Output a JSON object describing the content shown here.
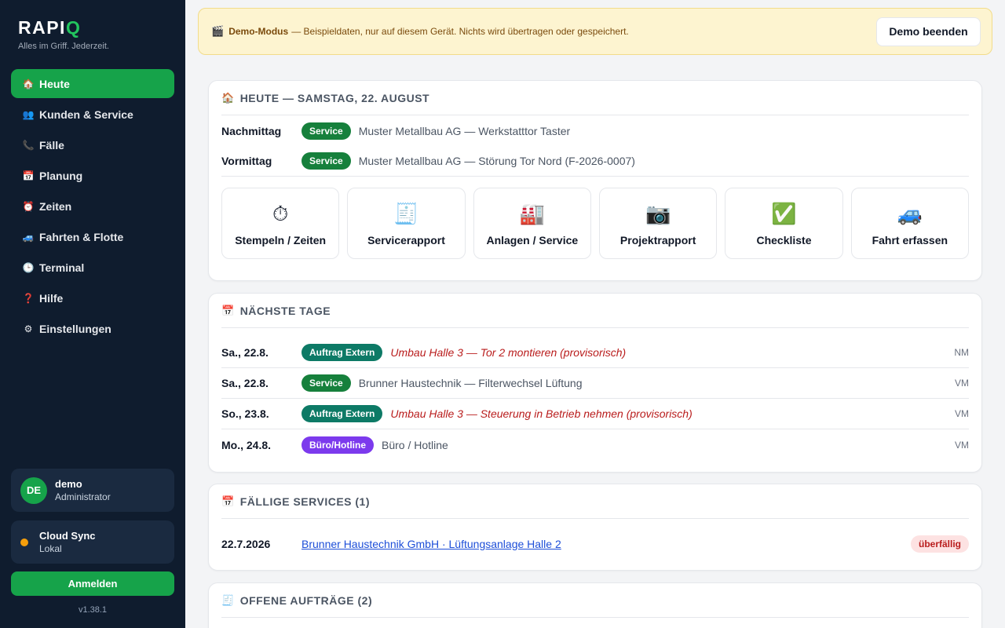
{
  "app": {
    "logo_main": "RAPI",
    "logo_accent": "Q",
    "tagline": "Alles im Griff. Jederzeit.",
    "version": "v1.38.1"
  },
  "nav": [
    {
      "label": "Heute",
      "icon": "house-icon",
      "glyph": "🏠",
      "active": true
    },
    {
      "label": "Kunden & Service",
      "icon": "people-icon",
      "glyph": "👥"
    },
    {
      "label": "Fälle",
      "icon": "phone-icon",
      "glyph": "📞"
    },
    {
      "label": "Planung",
      "icon": "calendar-icon",
      "glyph": "📅"
    },
    {
      "label": "Zeiten",
      "icon": "alarm-clock-icon",
      "glyph": "⏰"
    },
    {
      "label": "Fahrten & Flotte",
      "icon": "car-icon",
      "glyph": "🚙"
    },
    {
      "label": "Terminal",
      "icon": "clock-icon",
      "glyph": "🕒"
    },
    {
      "label": "Hilfe",
      "icon": "question-icon",
      "glyph": "❓"
    },
    {
      "label": "Einstellungen",
      "icon": "gear-icon",
      "glyph": "⚙"
    }
  ],
  "user": {
    "initials": "DE",
    "name": "demo",
    "role": "Administrator"
  },
  "sync": {
    "title": "Cloud Sync",
    "status": "Lokal"
  },
  "login_label": "Anmelden",
  "banner": {
    "icon": "clapper-icon",
    "title": "Demo-Modus",
    "text": "— Beispieldaten, nur auf diesem Gerät. Nichts wird übertragen oder gespeichert.",
    "button": "Demo beenden"
  },
  "today": {
    "title": "Heute — Samstag, 22. August",
    "rows": [
      {
        "label": "Nachmittag",
        "badge": "Service",
        "text": "Muster Metallbau AG — Werkstatttor Taster"
      },
      {
        "label": "Vormittag",
        "badge": "Service",
        "text": "Muster Metallbau AG — Störung Tor Nord (F-2026-0007)"
      }
    ],
    "tiles": [
      {
        "label": "Stempeln / Zeiten",
        "icon": "stopwatch-icon",
        "glyph": "⏱"
      },
      {
        "label": "Servicerapport",
        "icon": "receipt-icon",
        "glyph": "🧾"
      },
      {
        "label": "Anlagen / Service",
        "icon": "factory-icon",
        "glyph": "🏭"
      },
      {
        "label": "Projektrapport",
        "icon": "camera-icon",
        "glyph": "📷"
      },
      {
        "label": "Checkliste",
        "icon": "checkmark-icon",
        "glyph": "✅"
      },
      {
        "label": "Fahrt erfassen",
        "icon": "car-icon",
        "glyph": "🚙"
      }
    ]
  },
  "next_days": {
    "title": "Nächste Tage",
    "rows": [
      {
        "date": "Sa., 22.8.",
        "badge": "Auftrag Extern",
        "kind": "extern",
        "text": "Umbau Halle 3 — Tor 2 montieren (provisorisch)",
        "provisional": true,
        "slot": "NM"
      },
      {
        "date": "Sa., 22.8.",
        "badge": "Service",
        "kind": "service",
        "text": "Brunner Haustechnik — Filterwechsel Lüftung",
        "provisional": false,
        "slot": "VM"
      },
      {
        "date": "So., 23.8.",
        "badge": "Auftrag Extern",
        "kind": "extern",
        "text": "Umbau Halle 3 — Steuerung in Betrieb nehmen (provisorisch)",
        "provisional": true,
        "slot": "VM"
      },
      {
        "date": "Mo., 24.8.",
        "badge": "Büro/Hotline",
        "kind": "buero",
        "text": "Büro / Hotline",
        "provisional": false,
        "slot": "VM"
      }
    ]
  },
  "due_services": {
    "title": "Fällige Services (1)",
    "rows": [
      {
        "date": "22.7.2026",
        "link": "Brunner Haustechnik GmbH · Lüftungsanlage Halle 2",
        "status": "überfällig"
      }
    ]
  },
  "open_orders": {
    "title": "Offene Aufträge (2)"
  },
  "colors": {
    "sidebar_bg": "#0f1c2e",
    "accent_green": "#16a34a",
    "badge_extern": "#0d7a66",
    "badge_buero": "#7c3aed",
    "provisional_red": "#b91c1c",
    "sync_dot": "#f59e0b"
  }
}
